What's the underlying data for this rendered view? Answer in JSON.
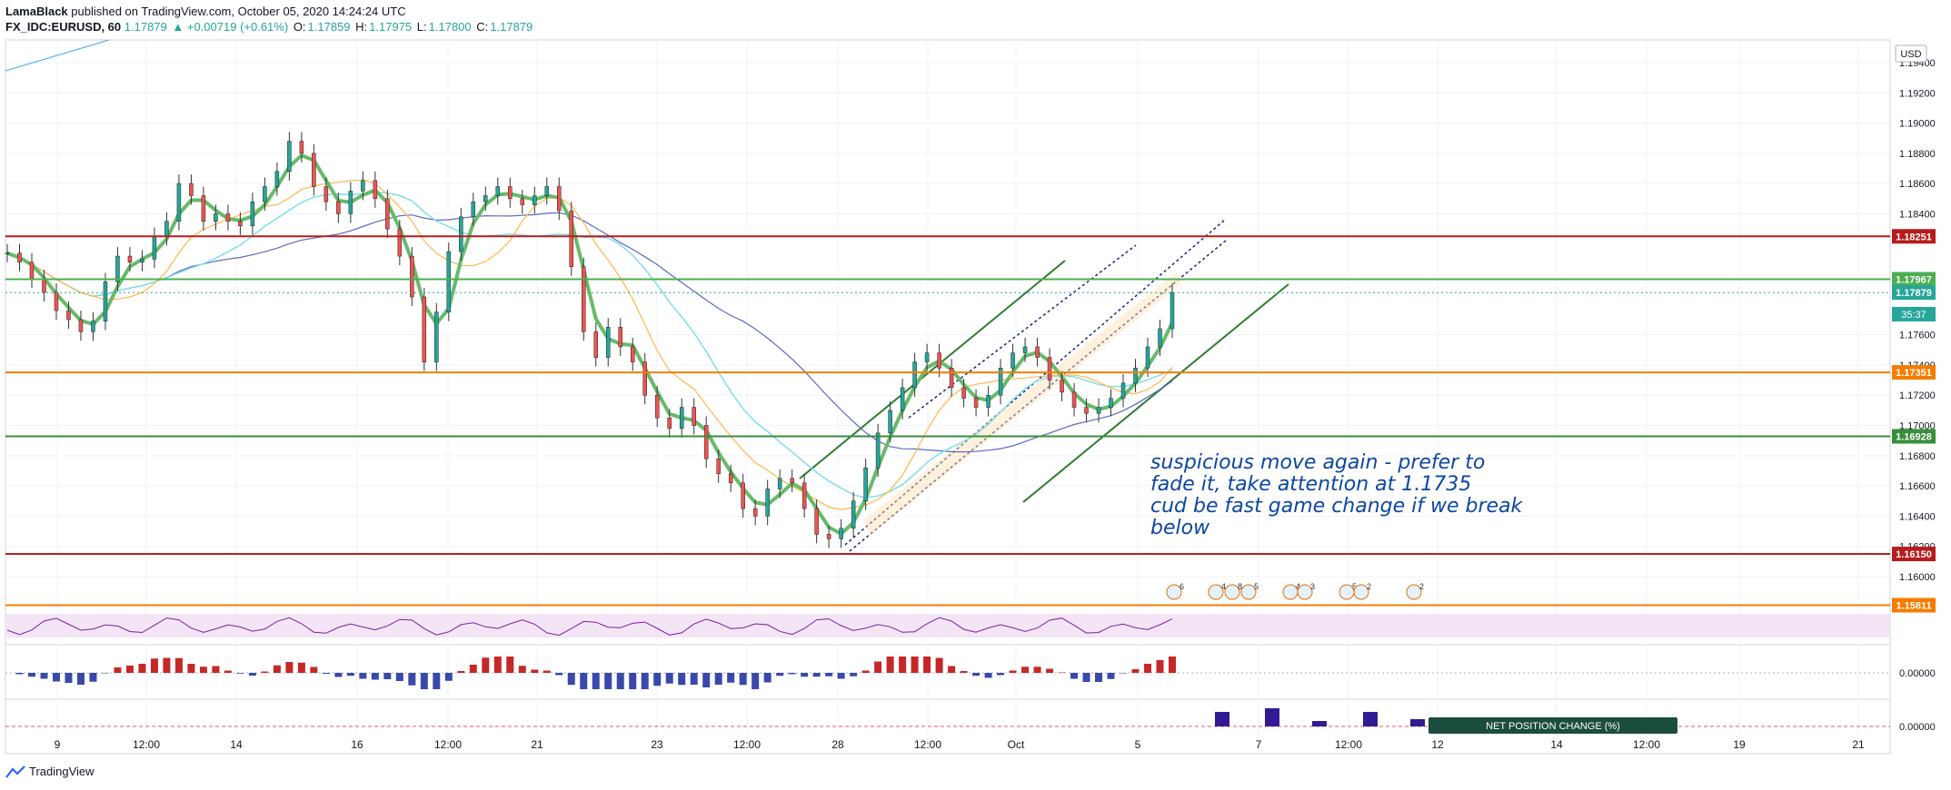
{
  "header": {
    "author": "LamaBlack",
    "published": "published on TradingView.com, October 05, 2020 14:24:24 UTC",
    "symbol": "FX_IDC:EURUSD, 60",
    "last": "1.17879",
    "change": "▲ +0.00719 (+0.61%)",
    "o_label": "O:",
    "o": "1.17859",
    "h_label": "H:",
    "h": "1.17975",
    "l_label": "L:",
    "l": "1.17800",
    "c_label": "C:",
    "c": "1.17879"
  },
  "brand": "TradingView",
  "currency": "USD",
  "annotation": [
    "suspicious move again - prefer to",
    "fade it, take attention at 1.1735",
    "cud be fast game change if we break",
    "below"
  ],
  "colors": {
    "up": "#26a69a",
    "down": "#ef5350",
    "red_line": "#b71c1c",
    "orange_line": "#f57c00",
    "green_line": "#388e3c",
    "text_blue": "#0d47a1",
    "axis_label_green": "#4caf50"
  },
  "chart_data": {
    "type": "line",
    "title": "",
    "x_ticks": [
      "9",
      "12:00",
      "14",
      "16",
      "12:00",
      "21",
      "23",
      "12:00",
      "28",
      "12:00",
      "Oct",
      "5",
      "7",
      "12:00",
      "12",
      "14",
      "12:00",
      "19",
      "21"
    ],
    "y_ticks": [
      "1.19400",
      "1.19200",
      "1.19000",
      "1.18800",
      "1.18600",
      "1.18400",
      "1.17600",
      "1.17400",
      "1.17200",
      "1.17000",
      "1.16800",
      "1.16600",
      "1.16400",
      "1.16200",
      "1.16000"
    ],
    "ylim": [
      1.1585,
      1.1955
    ],
    "horizontal_levels": [
      {
        "value": 1.18251,
        "label": "1.18251",
        "color": "#b71c1c"
      },
      {
        "value": 1.17967,
        "label": "1.17967",
        "color": "#4caf50"
      },
      {
        "value": 1.17879,
        "label": "1.17879",
        "color": "#26a69a"
      },
      {
        "value": 1.17351,
        "label": "1.17351",
        "color": "#f57c00"
      },
      {
        "value": 1.16928,
        "label": "1.16928",
        "color": "#388e3c"
      },
      {
        "value": 1.1615,
        "label": "1.16150",
        "color": "#b71c1c"
      },
      {
        "value": 1.15811,
        "label": "1.15811",
        "color": "#f57c00"
      }
    ],
    "countdown": "35:37",
    "price_series": [
      1.1814,
      1.1808,
      1.1797,
      1.1788,
      1.1776,
      1.177,
      1.1762,
      1.1769,
      1.1795,
      1.1812,
      1.1808,
      1.181,
      1.1825,
      1.1835,
      1.186,
      1.1852,
      1.1835,
      1.184,
      1.1835,
      1.1832,
      1.1848,
      1.1858,
      1.1868,
      1.1888,
      1.188,
      1.1858,
      1.1848,
      1.184,
      1.1855,
      1.1862,
      1.185,
      1.183,
      1.1812,
      1.1785,
      1.1742,
      1.1775,
      1.1815,
      1.1838,
      1.1848,
      1.1852,
      1.1858,
      1.185,
      1.1846,
      1.1852,
      1.1858,
      1.1842,
      1.1805,
      1.1762,
      1.1745,
      1.1765,
      1.1752,
      1.1742,
      1.172,
      1.1705,
      1.1698,
      1.1712,
      1.17,
      1.1678,
      1.1668,
      1.1662,
      1.1645,
      1.164,
      1.1658,
      1.1665,
      1.1662,
      1.1645,
      1.1628,
      1.1625,
      1.1632,
      1.165,
      1.1672,
      1.1695,
      1.171,
      1.1725,
      1.1742,
      1.1748,
      1.1738,
      1.1725,
      1.1718,
      1.1712,
      1.172,
      1.1738,
      1.1748,
      1.1752,
      1.1745,
      1.173,
      1.1722,
      1.1712,
      1.1708,
      1.1712,
      1.1718,
      1.1728,
      1.1738,
      1.1752,
      1.1764,
      1.1788
    ],
    "macd_zero": "0.00000",
    "cot_zero": "0.00000",
    "cot_label": "NET POSITION CHANGE (%)",
    "event_flags": [
      "6",
      "4",
      "8",
      "5",
      "4",
      "3",
      "5",
      "2",
      "2"
    ]
  }
}
